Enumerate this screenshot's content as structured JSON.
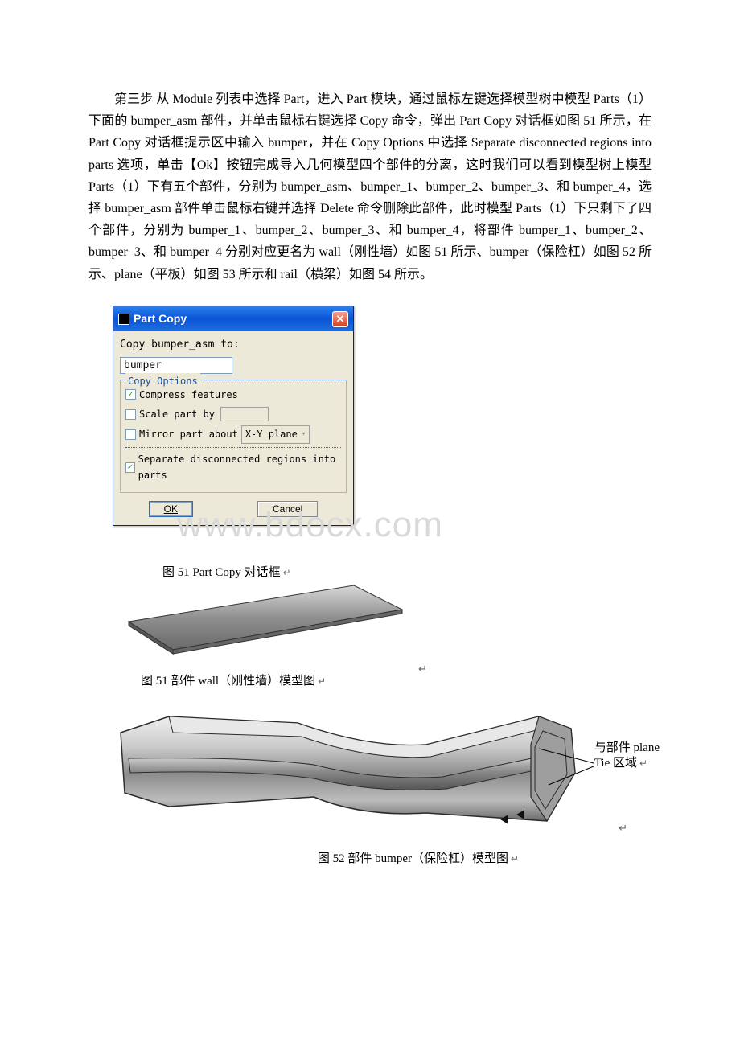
{
  "paragraph": "第三步 从 Module 列表中选择 Part，进入 Part 模块，通过鼠标左键选择模型树中模型 Parts（1）下面的 bumper_asm 部件，并单击鼠标右键选择 Copy 命令，弹出 Part Copy 对话框如图 51 所示，在 Part Copy 对话框提示区中输入 bumper，并在 Copy Options 中选择 Separate disconnected regions into parts 选项，单击【Ok】按钮完成导入几何模型四个部件的分离，这时我们可以看到模型树上模型 Parts（1）下有五个部件，分别为 bumper_asm、bumper_1、bumper_2、bumper_3、和 bumper_4，选择 bumper_asm 部件单击鼠标右键并选择 Delete 命令删除此部件，此时模型 Parts（1）下只剩下了四个部件，分别为 bumper_1、bumper_2、bumper_3、和 bumper_4，将部件 bumper_1、bumper_2、bumper_3、和 bumper_4 分别对应更名为 wall（刚性墙）如图 51 所示、bumper（保险杠）如图 52 所示、plane（平板）如图 53 所示和 rail（横梁）如图 54 所示。",
  "dialog": {
    "title": "Part Copy",
    "close": "✕",
    "prompt": "Copy bumper_asm to:",
    "input_value": "bumper",
    "options_legend": "Copy Options",
    "opt_compress": "Compress features",
    "opt_scale": "Scale part by",
    "opt_mirror_label": "Mirror part about",
    "opt_mirror_value": "X-Y plane",
    "opt_separate": "Separate disconnected regions into parts",
    "ok": "OK",
    "cancel": "Cancel"
  },
  "watermark": "www.bdocx.com",
  "captions": {
    "fig51_dialog": "图 51    Part Copy 对话框",
    "fig51_wall": "图 51    部件 wall（刚性墙）模型图",
    "fig52_bumper": "图 52    部件 bumper（保险杠）模型图"
  },
  "annotation": {
    "line1": "与部件 plane",
    "line2": "Tie 区域"
  },
  "return_symbol": "↵"
}
